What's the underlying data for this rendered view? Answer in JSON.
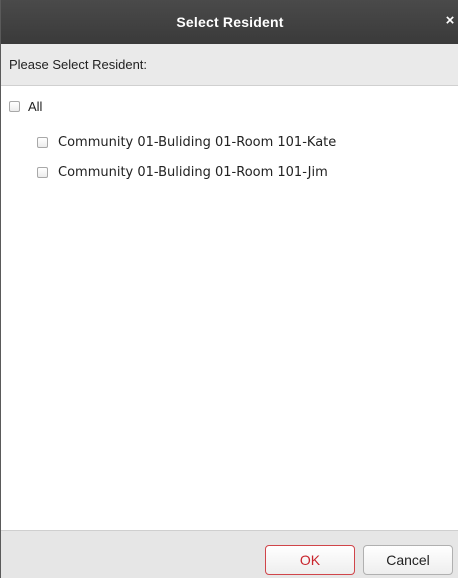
{
  "dialog": {
    "title": "Select Resident",
    "close_glyph": "×",
    "prompt": "Please Select Resident:"
  },
  "tree": {
    "all_label": "All",
    "items": [
      {
        "label": "Community 01-Buliding 01-Room 101-Kate",
        "checked": false
      },
      {
        "label": "Community 01-Buliding 01-Room 101-Jim",
        "checked": false
      }
    ],
    "all_checked": false
  },
  "footer": {
    "ok_label": "OK",
    "cancel_label": "Cancel"
  },
  "colors": {
    "titlebar": "#3f3f3f",
    "ok_accent": "#c9252d"
  },
  "icons": {
    "close": "close-icon"
  }
}
